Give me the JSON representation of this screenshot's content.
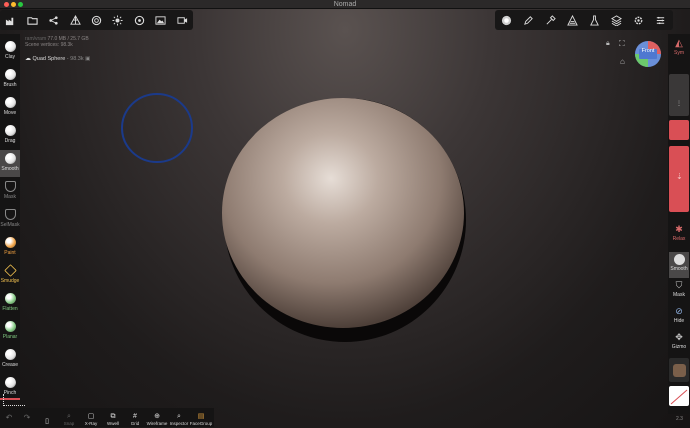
{
  "window": {
    "title": "Nomad"
  },
  "scene": {
    "memory": "77.0 MB / 25.7 GB",
    "memory_prefix": "ram/vram",
    "vertices_label": "Scene vertices:",
    "vertices_value": "98.3k",
    "mesh_name": "Quad Sphere",
    "mesh_count": "98.3k"
  },
  "gizmo": {
    "label": "Front"
  },
  "left_tools": [
    {
      "name": "clay",
      "label": "Clay",
      "color": "#e0e0e0"
    },
    {
      "name": "brush",
      "label": "Brush",
      "color": "#e0e0e0"
    },
    {
      "name": "move",
      "label": "Move",
      "color": "#e0e0e0"
    },
    {
      "name": "drag",
      "label": "Drag",
      "color": "#e0e0e0"
    },
    {
      "name": "smooth",
      "label": "Smooth",
      "color": "#e0e0e0"
    },
    {
      "name": "mask",
      "label": "Mask",
      "color": "#888"
    },
    {
      "name": "selmask",
      "label": "SelMask",
      "color": "#888"
    },
    {
      "name": "paint",
      "label": "Paint",
      "color": "#f0a040"
    },
    {
      "name": "smudge",
      "label": "Smudge",
      "color": "#f0c050"
    },
    {
      "name": "flatten",
      "label": "Flatten",
      "color": "#7fc77f"
    },
    {
      "name": "planar",
      "label": "Planar",
      "color": "#7fc77f"
    },
    {
      "name": "crease",
      "label": "Crease",
      "color": "#e0e0e0"
    },
    {
      "name": "pinch",
      "label": "Pinch",
      "color": "#e0e0e0"
    }
  ],
  "right_tools": {
    "sym": "Sym",
    "relax": "Relax",
    "smooth": "Smooth",
    "mask": "Mask",
    "hide": "Hide",
    "gizmo": "Gizmo"
  },
  "bottom_tools": [
    {
      "name": "undo",
      "label": "",
      "icon": "↶",
      "dim": true
    },
    {
      "name": "redo",
      "label": "",
      "icon": "↷",
      "dim": true
    },
    {
      "name": "voxel",
      "label": "",
      "icon": "▯",
      "dim": false
    },
    {
      "name": "snap",
      "label": "Snap",
      "icon": "⌕",
      "dim": true
    },
    {
      "name": "xray",
      "label": "X-Ray",
      "icon": "▢",
      "dim": false
    },
    {
      "name": "wireframe-quick",
      "label": "Wwell",
      "icon": "⧉",
      "dim": false
    },
    {
      "name": "grid",
      "label": "Grid",
      "icon": "#",
      "dim": false
    },
    {
      "name": "wireframe",
      "label": "Wireframe",
      "icon": "⊕",
      "dim": false
    },
    {
      "name": "inspector",
      "label": "Inspector",
      "icon": "⌕",
      "dim": false
    },
    {
      "name": "face-group",
      "label": "FaceGroup",
      "icon": "▤",
      "dim": false
    }
  ],
  "version": "2.3"
}
